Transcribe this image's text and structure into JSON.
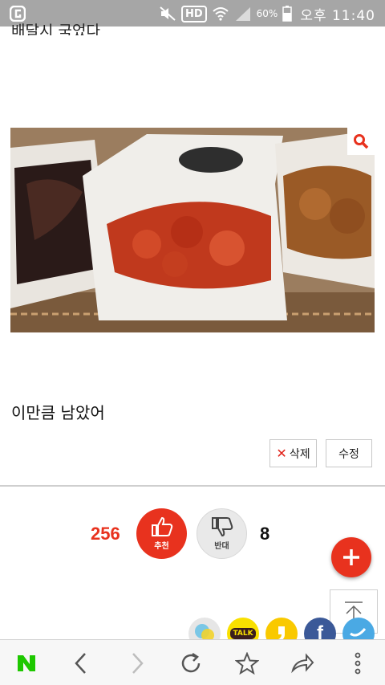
{
  "status_bar": {
    "battery": "60%",
    "time": "오후 11:40",
    "hd_label": "HD"
  },
  "post": {
    "cut_text": "배달시 국었다",
    "body_text": "이만큼 남았어"
  },
  "actions": {
    "delete_label": "삭제",
    "edit_label": "수정"
  },
  "votes": {
    "up_count": "256",
    "up_label": "추천",
    "down_count": "8",
    "down_label": "반대"
  },
  "share": {
    "talk_label": "TALK",
    "facebook_label": "f"
  },
  "browser_bar": {
    "logo": "N"
  },
  "colors": {
    "accent_red": "#e8321e",
    "naver_green": "#1ec800"
  }
}
